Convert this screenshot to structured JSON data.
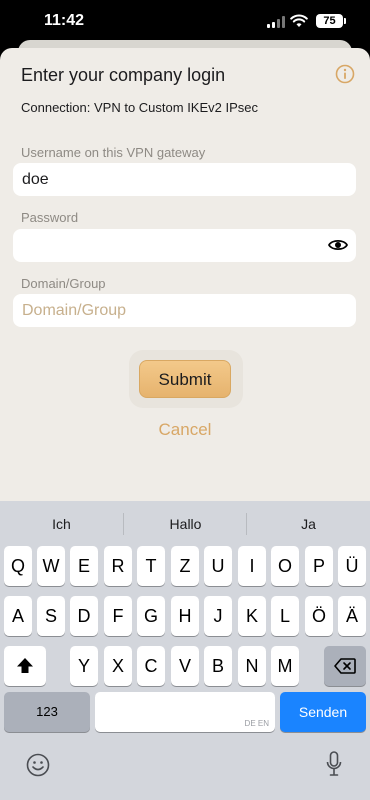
{
  "status_bar": {
    "time": "11:42",
    "battery": "75"
  },
  "sheet": {
    "title": "Enter your company login",
    "connection": "Connection: VPN to Custom IKEv2 IPsec",
    "username_label": "Username on this VPN gateway",
    "username_value": "doe",
    "password_label": "Password",
    "password_value": "",
    "domain_label": "Domain/Group",
    "domain_placeholder": "Domain/Group",
    "submit_label": "Submit",
    "cancel_label": "Cancel"
  },
  "keyboard": {
    "suggestions": [
      "Ich",
      "Hallo",
      "Ja"
    ],
    "row1": [
      "Q",
      "W",
      "E",
      "R",
      "T",
      "Z",
      "U",
      "I",
      "O",
      "P",
      "Ü"
    ],
    "row2": [
      "A",
      "S",
      "D",
      "F",
      "G",
      "H",
      "J",
      "K",
      "L",
      "Ö",
      "Ä"
    ],
    "row3": [
      "Y",
      "X",
      "C",
      "V",
      "B",
      "N",
      "M"
    ],
    "numbers_label": "123",
    "space_lang_hint": "DE EN",
    "return_label": "Senden"
  },
  "colors": {
    "accent": "#e6b36e",
    "sheet_background": "#efece7",
    "keyboard_background": "#d3d6dc",
    "return_key": "#1a84ff"
  }
}
